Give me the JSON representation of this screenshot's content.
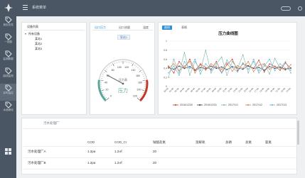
{
  "sidebar": {
    "items": [
      {
        "label": "首页总览",
        "icon": "tag-icon"
      },
      {
        "label": "一张图",
        "icon": "tag-icon"
      },
      {
        "label": "监测数据",
        "icon": "tag-icon"
      },
      {
        "label": "曲线监测",
        "icon": "tag-icon"
      },
      {
        "label": "实时监控",
        "icon": "tag-icon",
        "active": true
      },
      {
        "label": "水池绿化",
        "icon": "tag-icon"
      }
    ],
    "bottom_icon": "grid-icon"
  },
  "header": {
    "title": "系统菜单"
  },
  "tree": {
    "title": "设备列表",
    "root": "所有设备",
    "children": [
      "某站1",
      "某站2",
      "某站3"
    ]
  },
  "gauge_panel": {
    "tabs": [
      "出口压力",
      "出口流量",
      "温度"
    ],
    "active_tab": 0,
    "station_button": "泵站1",
    "unit_label": "压力表",
    "value_label": "压力",
    "ticks": [
      "0",
      "20",
      "40",
      "60",
      "80",
      "100",
      "120",
      "140",
      "160",
      "180",
      "200",
      "220"
    ],
    "value": 60
  },
  "chart_panel": {
    "tabs": [
      "曲线",
      "表格"
    ],
    "active_tab": 0
  },
  "chart_data": {
    "type": "line",
    "title": "压力曲线图",
    "ylim": [
      0,
      1
    ],
    "yticks": [
      "0",
      "0.2",
      "0.4",
      "0.6",
      "0.8",
      "1"
    ],
    "x": [
      "00:00",
      "01:00",
      "02:00",
      "03:00",
      "04:00",
      "05:00",
      "06:00",
      "07:00",
      "08:00",
      "09:00",
      "10:00",
      "11:00",
      "12:00",
      "13:00",
      "14:00",
      "15:00",
      "16:00",
      "17:00",
      "18:00",
      "19:00",
      "20:00",
      "21:00",
      "22:00",
      "23:00"
    ],
    "series": [
      {
        "name": "2016/12/30",
        "color": "#c0392b",
        "values": [
          0.45,
          0.3,
          0.55,
          0.4,
          0.6,
          0.35,
          0.5,
          0.42,
          0.38,
          0.55,
          0.3,
          0.48,
          0.6,
          0.35,
          0.5,
          0.45,
          0.4,
          0.58,
          0.32,
          0.5,
          0.44,
          0.36,
          0.52,
          0.4
        ]
      },
      {
        "name": "2016/12/31",
        "color": "#2c3e50",
        "values": [
          0.42,
          0.38,
          0.45,
          0.4,
          0.44,
          0.36,
          0.42,
          0.39,
          0.45,
          0.4,
          0.43,
          0.37,
          0.44,
          0.41,
          0.38,
          0.46,
          0.4,
          0.42,
          0.36,
          0.44,
          0.4,
          0.43,
          0.38,
          0.41
        ]
      },
      {
        "name": "2017/1/1",
        "color": "#7fb5a8",
        "values": [
          0.2,
          0.6,
          0.3,
          0.75,
          0.25,
          0.55,
          0.35,
          0.8,
          0.3,
          0.5,
          0.65,
          0.25,
          0.55,
          0.4,
          0.7,
          0.3,
          0.6,
          0.35,
          0.5,
          0.28,
          0.62,
          0.4,
          0.55,
          0.3
        ]
      },
      {
        "name": "2017/1/2",
        "color": "#e07b39",
        "values": [
          0.4,
          0.5,
          0.35,
          0.45,
          0.55,
          0.3,
          0.48,
          0.36,
          0.5,
          0.42,
          0.38,
          0.52,
          0.34,
          0.46,
          0.4,
          0.55,
          0.33,
          0.47,
          0.5,
          0.38,
          0.45,
          0.41,
          0.36,
          0.48
        ]
      },
      {
        "name": "2017/1/3",
        "color": "#5fb3d9",
        "values": [
          0.3,
          0.45,
          0.25,
          0.55,
          0.4,
          0.6,
          0.28,
          0.5,
          0.35,
          0.45,
          0.3,
          0.58,
          0.42,
          0.32,
          0.52,
          0.38,
          0.55,
          0.3,
          0.45,
          0.6,
          0.35,
          0.5,
          0.4,
          0.36
        ]
      }
    ]
  },
  "table": {
    "title": "污水处理厂",
    "columns": [
      "",
      "COD",
      "COD_Cr",
      "钠酸盐氮",
      "溶解氧",
      "总磷",
      "总氮",
      "氨氮"
    ],
    "rows": [
      [
        "污水处理厂A",
        "1.2pa",
        "1.2㎡",
        "20",
        "",
        "",
        "",
        ""
      ],
      [
        "污水处理厂B",
        "1.2pa",
        "1.2㎡",
        "20",
        "",
        "",
        "",
        ""
      ]
    ]
  }
}
